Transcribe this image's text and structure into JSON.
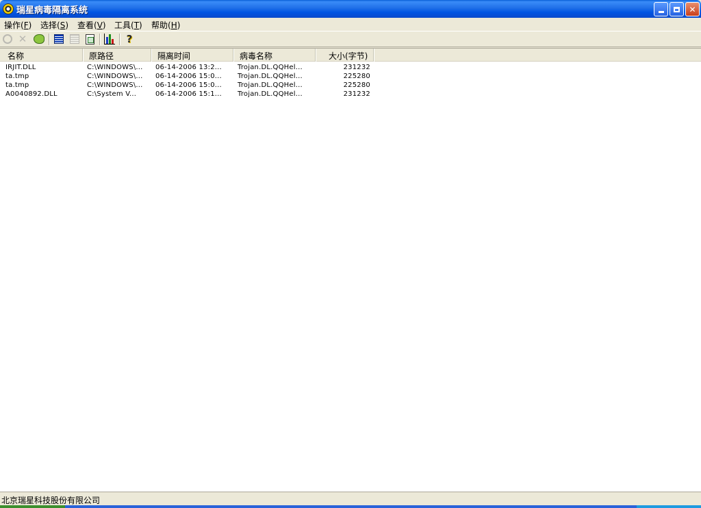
{
  "window": {
    "title": "瑞星病毒隔离系统"
  },
  "menu": [
    {
      "label": "操作",
      "key": "F"
    },
    {
      "label": "选择",
      "key": "S"
    },
    {
      "label": "查看",
      "key": "V"
    },
    {
      "label": "工具",
      "key": "T"
    },
    {
      "label": "帮助",
      "key": "H"
    }
  ],
  "toolbar": {
    "buttons": [
      {
        "icon": "restore-circle-icon",
        "enabled": false
      },
      {
        "icon": "delete-x-icon",
        "enabled": false
      },
      {
        "icon": "restore-file-icon",
        "enabled": true
      },
      {
        "icon": "details-view-icon",
        "enabled": true
      },
      {
        "icon": "list-view-icon",
        "enabled": false
      },
      {
        "icon": "document-view-icon",
        "enabled": true
      },
      {
        "icon": "statistics-chart-icon",
        "enabled": true
      },
      {
        "icon": "help-icon",
        "enabled": true
      }
    ]
  },
  "table": {
    "columns": [
      "名称",
      "原路径",
      "隔离时间",
      "病毒名称",
      "大小(字节)"
    ],
    "rows": [
      [
        "IRJIT.DLL",
        "C:\\WINDOWS\\...",
        "06-14-2006 13:2...",
        "Trojan.DL.QQHel...",
        "231232"
      ],
      [
        "ta.tmp",
        "C:\\WINDOWS\\...",
        "06-14-2006 15:0...",
        "Trojan.DL.QQHel...",
        "225280"
      ],
      [
        "ta.tmp",
        "C:\\WINDOWS\\...",
        "06-14-2006 15:0...",
        "Trojan.DL.QQHel...",
        "225280"
      ],
      [
        "A0040892.DLL",
        "C:\\System V...",
        "06-14-2006 15:1...",
        "Trojan.DL.QQHel...",
        "231232"
      ]
    ]
  },
  "status": {
    "text": "北京瑞星科技股份有限公司"
  },
  "colors": {
    "titlebar": "#0054E3",
    "face": "#ECE9D8",
    "close_button": "#C8401C"
  }
}
